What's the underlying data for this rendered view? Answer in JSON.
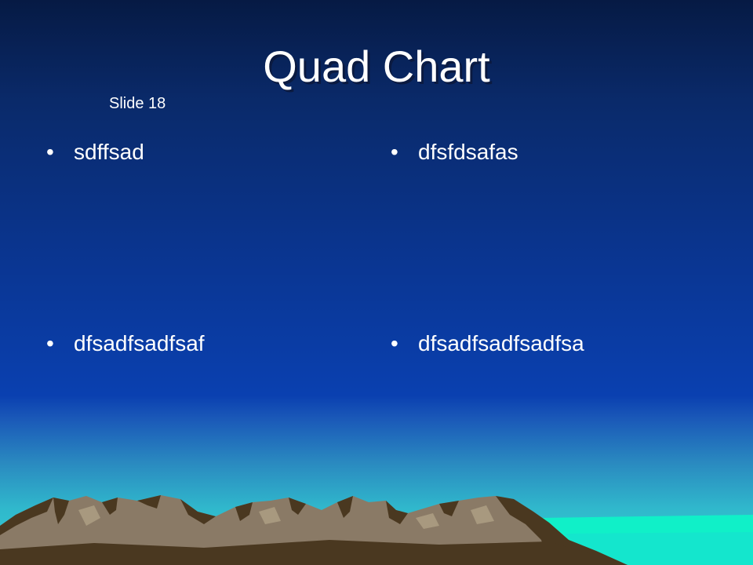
{
  "slide": {
    "title": "Quad Chart",
    "slide_number_label": "Slide 18",
    "bullet_glyph": "•",
    "bullets": [
      {
        "text": "sdffsad"
      },
      {
        "text": "dfsfdsafas"
      },
      {
        "text": "dfsadfsadfsaf"
      },
      {
        "text": "dfsadfsadfsadfsa"
      }
    ]
  },
  "colors": {
    "text": "#ffffff",
    "sky_top": "#061a44",
    "sky_mid": "#0a40b0",
    "horizon": "#34d2d2",
    "water": "#10f0c8",
    "mountain_light": "#8a7a66",
    "mountain_dark": "#4a3820"
  }
}
